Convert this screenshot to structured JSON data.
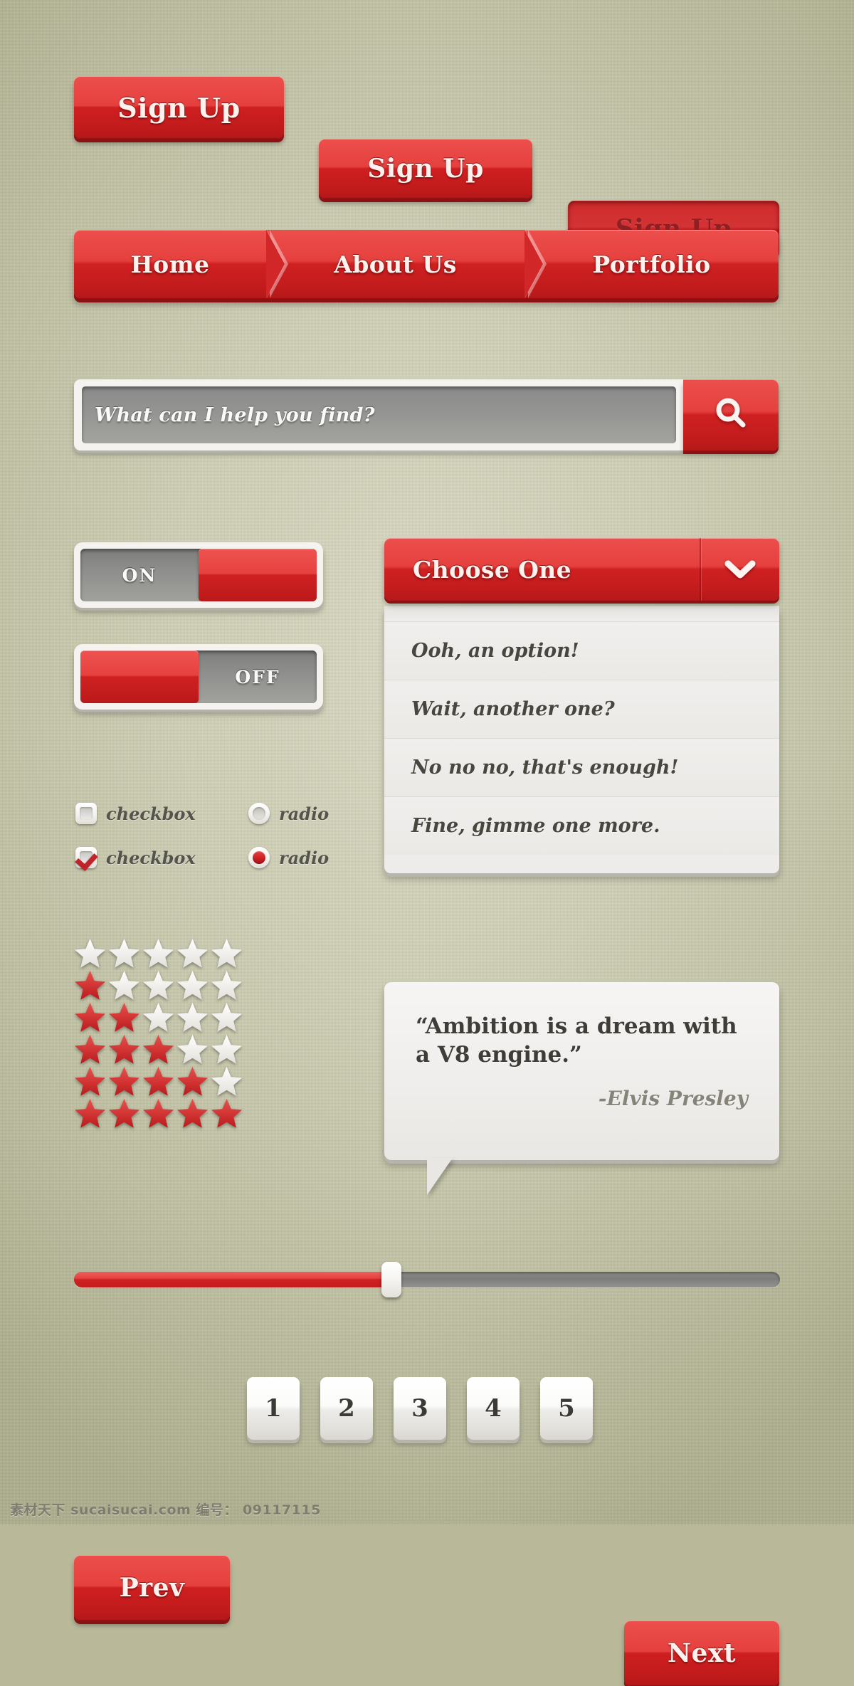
{
  "theme": {
    "background": "#cfcfb6",
    "accent_red": "#cf2021",
    "accent_red_light": "#ec4f4c",
    "accent_red_dark": "#8d1113",
    "panel_white": "#f4f3f0",
    "track_gray": "#8e8e8c",
    "text_dark": "#3e3d38"
  },
  "buttons": [
    {
      "label": "Sign Up",
      "state": "normal"
    },
    {
      "label": "Sign Up",
      "state": "normal"
    },
    {
      "label": "Sign Up",
      "state": "pressed"
    }
  ],
  "nav": {
    "items": [
      {
        "label": "Home"
      },
      {
        "label": "About Us"
      },
      {
        "label": "Portfolio"
      }
    ]
  },
  "search": {
    "placeholder": "What can I help you find?",
    "value": "",
    "button_icon": "search-icon"
  },
  "toggles": [
    {
      "state": "ON",
      "checked": true
    },
    {
      "state": "OFF",
      "checked": false
    }
  ],
  "options": [
    {
      "type": "checkbox",
      "label": "checkbox",
      "checked": false
    },
    {
      "type": "radio",
      "label": "radio",
      "checked": false
    },
    {
      "type": "checkbox",
      "label": "checkbox",
      "checked": true
    },
    {
      "type": "radio",
      "label": "radio",
      "checked": true
    }
  ],
  "dropdown": {
    "selected_label": "Choose One",
    "arrow_icon": "chevron-down-icon",
    "options": [
      "Ooh, an option!",
      "Wait, another one?",
      "No no no, that's enough!",
      "Fine, gimme one more."
    ]
  },
  "ratings": {
    "max": 5,
    "rows": [
      0,
      1,
      2,
      3,
      4,
      5
    ]
  },
  "quote": {
    "text": "“Ambition is a dream with a V8 engine.”",
    "author": "-Elvis Presley"
  },
  "slider": {
    "value": 45,
    "min": 0,
    "max": 100
  },
  "pagination": {
    "prev_label": "Prev",
    "next_label": "Next",
    "pages": [
      "1",
      "2",
      "3",
      "4",
      "5"
    ]
  },
  "watermark": "素材天下 sucaisucai.com 编号： 09117115"
}
